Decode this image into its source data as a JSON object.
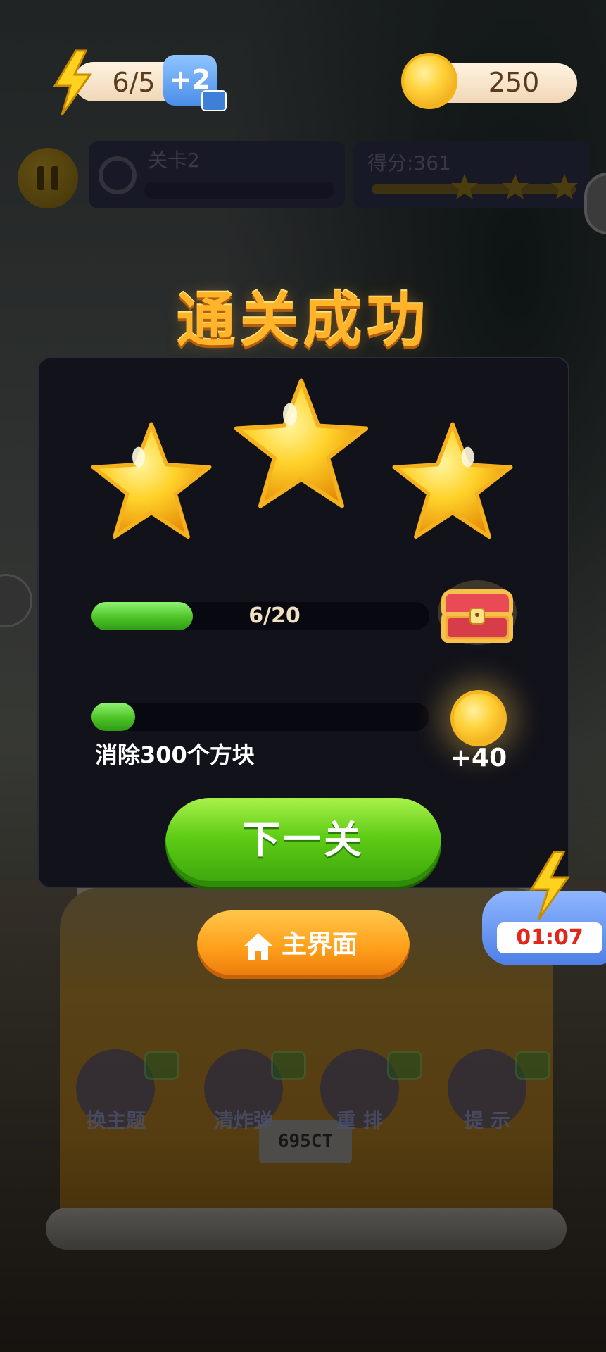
{
  "hud": {
    "energy": "6/5",
    "energy_plus": "+2",
    "coins": "250",
    "level": "关卡2",
    "score": "得分:361"
  },
  "result": {
    "title": "通关成功",
    "stars": 3,
    "progress_text": "6/20",
    "progress_value": 0.3,
    "task_progress_value": 0.13,
    "task_label": "消除300个方块",
    "task_reward": "+40",
    "next_button": "下一关",
    "home_button": "主界面"
  },
  "timer": {
    "value": "01:07"
  },
  "tools": [
    {
      "label": "换主题"
    },
    {
      "label": "清炸弹"
    },
    {
      "label": "重 排"
    },
    {
      "label": "提 示"
    }
  ],
  "background": {
    "plate": "695CT"
  },
  "colors": {
    "title": "#ffb42a",
    "next_button": "#5dcc15",
    "home_button": "#ff9f1a",
    "timer_text": "#e0261d"
  }
}
